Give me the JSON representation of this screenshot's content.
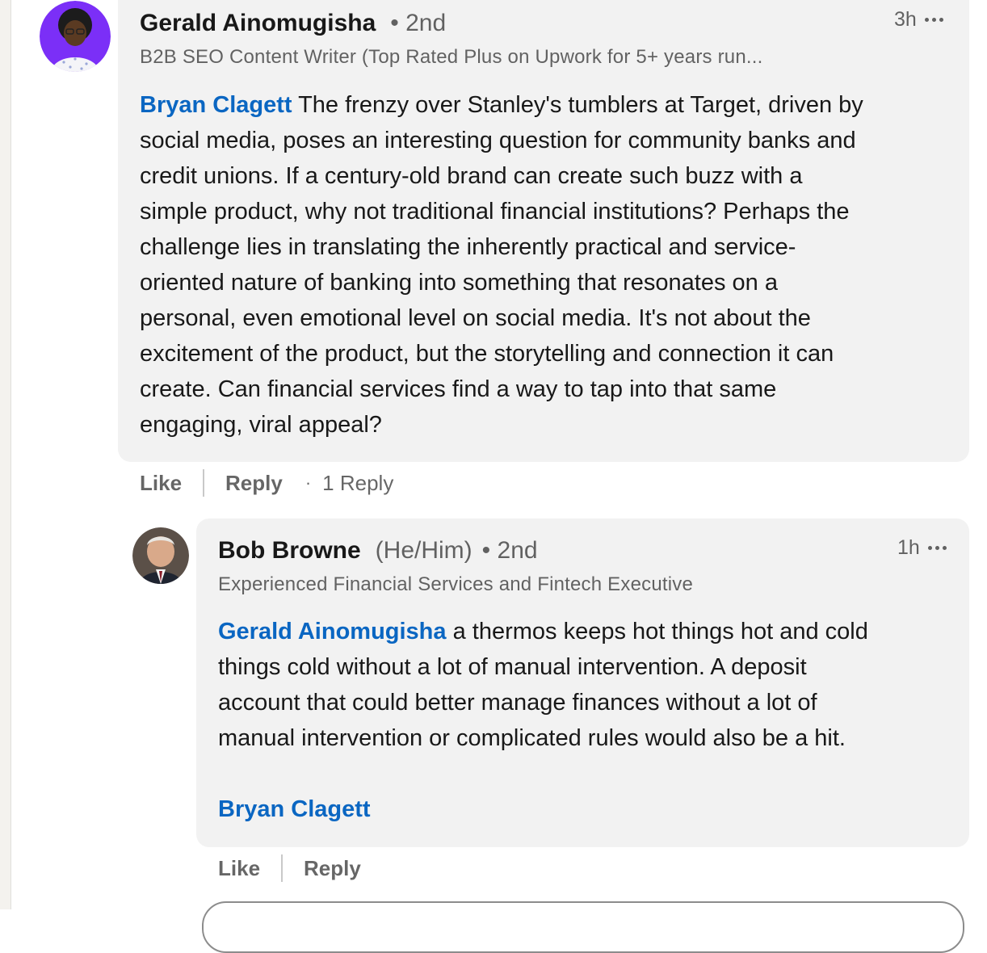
{
  "comment": {
    "author": "Gerald Ainomugisha",
    "degree": "• 2nd",
    "headline": "B2B SEO Content Writer (Top Rated Plus on Upwork for 5+ years run...",
    "timestamp": "3h",
    "mention": "Bryan Clagett",
    "lines": [
      " The frenzy over Stanley's tumblers at Target, driven by",
      "social media, poses an interesting question for community banks and",
      "credit unions. If a century-old brand can create such buzz with a",
      "simple product, why not traditional financial institutions? Perhaps the",
      "challenge lies in translating the inherently practical and service-",
      "oriented nature of banking into something that resonates on a",
      "personal, even emotional level on social media. It's not about the",
      "excitement of the product, but the storytelling and connection it can",
      "create. Can financial services find a way to tap into that same",
      "engaging, viral appeal?"
    ],
    "actions": {
      "like": "Like",
      "reply": "Reply",
      "separator": "·",
      "reply_count": "1 Reply"
    }
  },
  "reply": {
    "author": "Bob Browne",
    "pronouns": "(He/Him)",
    "degree": "• 2nd",
    "headline": "Experienced Financial Services and Fintech Executive",
    "timestamp": "1h",
    "mention": "Gerald Ainomugisha",
    "lines": [
      " a thermos keeps hot things hot and cold",
      "things cold without a lot of manual intervention. A deposit",
      "account that could better manage finances without a lot of",
      "manual intervention or complicated rules would also be a hit."
    ],
    "tag_mention": "Bryan Clagett",
    "actions": {
      "like": "Like",
      "reply": "Reply"
    }
  },
  "colors": {
    "mention": "#0a66c2",
    "bubble": "#f2f2f2",
    "avatar_purple": "#7b2ff7"
  }
}
